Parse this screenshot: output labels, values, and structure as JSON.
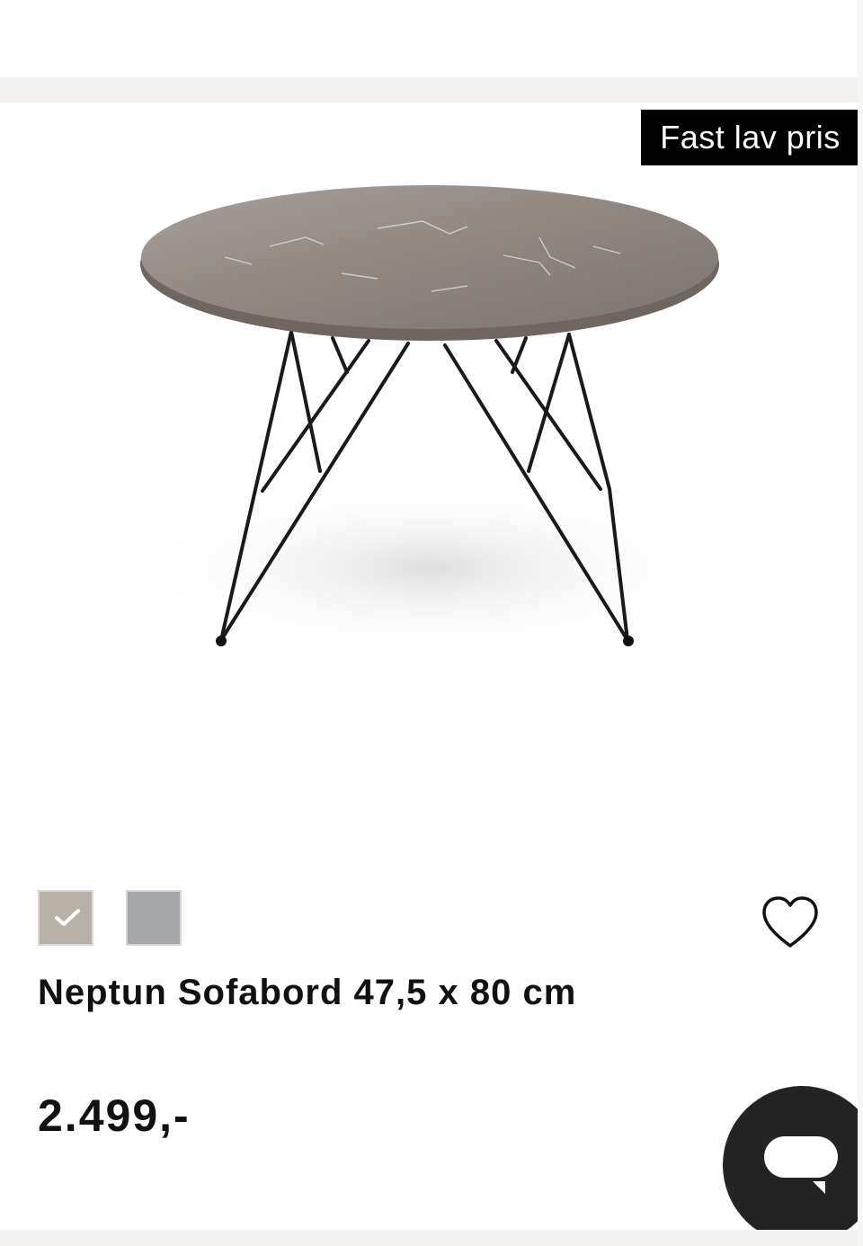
{
  "badge": {
    "label": "Fast lav pris"
  },
  "product": {
    "name": "Neptun Sofabord 47,5 x 80 cm",
    "price": "2.499,-",
    "image_alt": "Neptun Sofabord with round marble top and black wire legs"
  },
  "swatches": [
    {
      "color": "#b8b1a8",
      "selected": true
    },
    {
      "color": "#a5a7aa",
      "selected": false
    }
  ],
  "icons": {
    "favorite": "heart-icon",
    "chat": "chat-bubble-icon",
    "selected": "check-icon"
  }
}
